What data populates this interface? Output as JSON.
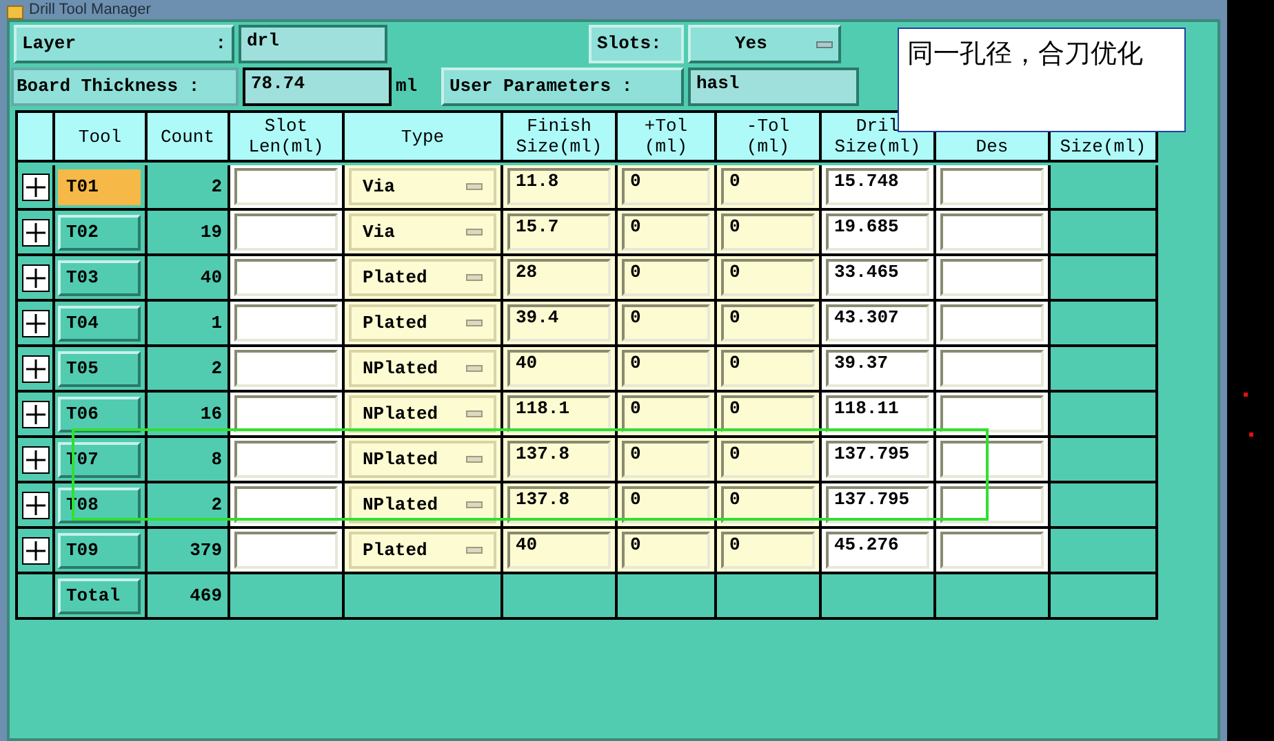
{
  "window": {
    "title": "Drill Tool Manager"
  },
  "layer": {
    "label": "Layer",
    "colon": ":",
    "value": "drl"
  },
  "slots": {
    "label": "Slots:",
    "value": "Yes"
  },
  "board_thickness": {
    "label": "Board Thickness :",
    "value": "78.74",
    "unit": "ml"
  },
  "user_parameters": {
    "label": "User Parameters :",
    "value": "hasl"
  },
  "note": {
    "text": "同一孔径，合刀优化"
  },
  "table": {
    "columns": [
      [
        "Tool"
      ],
      [
        "Count"
      ],
      [
        "Slot",
        "Len(ml)"
      ],
      [
        "Type"
      ],
      [
        "Finish",
        "Size(ml)"
      ],
      [
        "+Tol",
        "(ml)"
      ],
      [
        "-Tol",
        "(ml)"
      ],
      [
        "Dril",
        "Size(ml)"
      ],
      [
        "Des"
      ],
      [
        "Size(ml)"
      ]
    ],
    "rows": [
      {
        "tool": "T01",
        "selected": true,
        "count": "2",
        "type": "Via",
        "finish": "11.8",
        "plus_tol": "0",
        "minus_tol": "0",
        "drill_size": "15.748"
      },
      {
        "tool": "T02",
        "selected": false,
        "count": "19",
        "type": "Via",
        "finish": "15.7",
        "plus_tol": "0",
        "minus_tol": "0",
        "drill_size": "19.685"
      },
      {
        "tool": "T03",
        "selected": false,
        "count": "40",
        "type": "Plated",
        "finish": "28",
        "plus_tol": "0",
        "minus_tol": "0",
        "drill_size": "33.465"
      },
      {
        "tool": "T04",
        "selected": false,
        "count": "1",
        "type": "Plated",
        "finish": "39.4",
        "plus_tol": "0",
        "minus_tol": "0",
        "drill_size": "43.307"
      },
      {
        "tool": "T05",
        "selected": false,
        "count": "2",
        "type": "NPlated",
        "finish": "40",
        "plus_tol": "0",
        "minus_tol": "0",
        "drill_size": "39.37"
      },
      {
        "tool": "T06",
        "selected": false,
        "count": "16",
        "type": "NPlated",
        "finish": "118.1",
        "plus_tol": "0",
        "minus_tol": "0",
        "drill_size": "118.11"
      },
      {
        "tool": "T07",
        "selected": false,
        "count": "8",
        "type": "NPlated",
        "finish": "137.8",
        "plus_tol": "0",
        "minus_tol": "0",
        "drill_size": "137.795"
      },
      {
        "tool": "T08",
        "selected": false,
        "count": "2",
        "type": "NPlated",
        "finish": "137.8",
        "plus_tol": "0",
        "minus_tol": "0",
        "drill_size": "137.795"
      },
      {
        "tool": "T09",
        "selected": false,
        "count": "379",
        "type": "Plated",
        "finish": "40",
        "plus_tol": "0",
        "minus_tol": "0",
        "drill_size": "45.276"
      }
    ],
    "total": {
      "label": "Total",
      "count": "469"
    }
  }
}
